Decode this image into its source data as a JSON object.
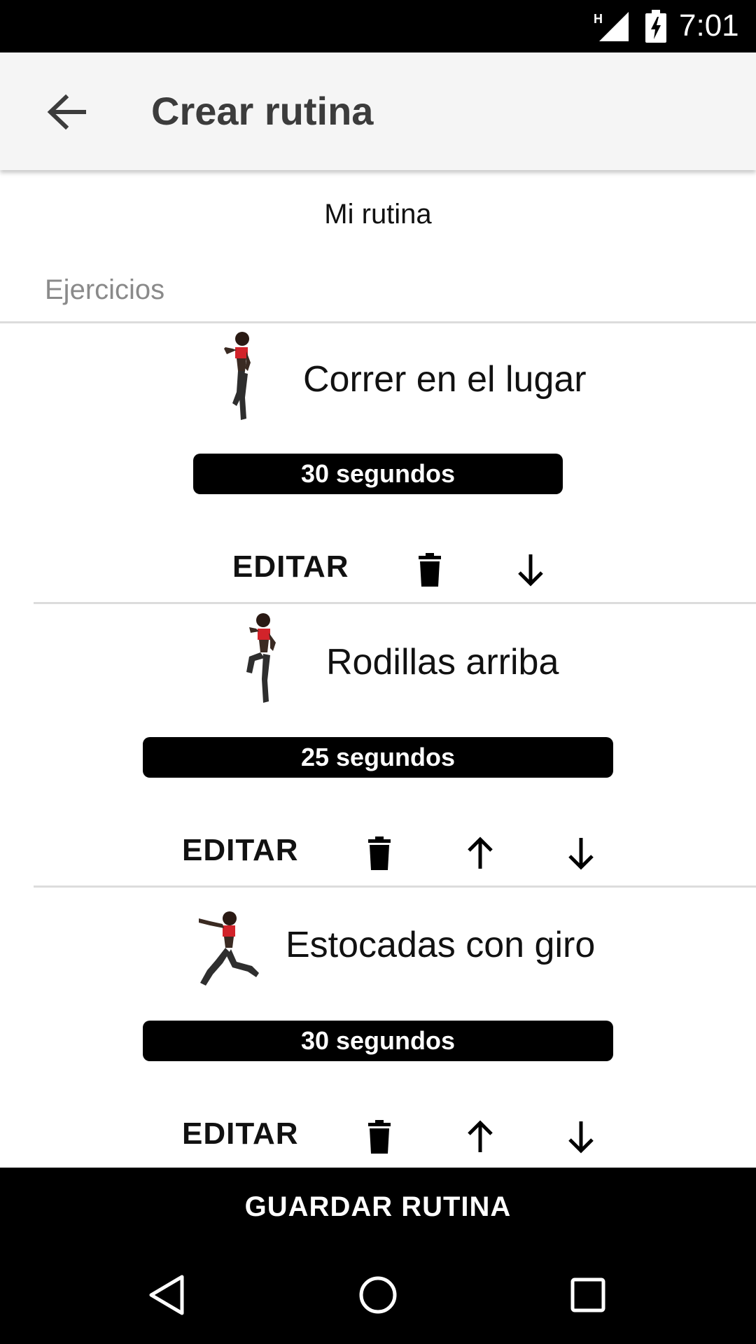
{
  "status_bar": {
    "network_label": "H",
    "time": "7:01"
  },
  "app_bar": {
    "back_icon": "arrow-left-icon",
    "title": "Crear rutina"
  },
  "routine": {
    "name": "Mi rutina",
    "section_label": "Ejercicios"
  },
  "exercises": [
    {
      "name": "Correr en el lugar",
      "duration": "30 segundos",
      "edit_label": "EDITAR",
      "actions": [
        "delete-icon",
        "arrow-down-icon"
      ]
    },
    {
      "name": "Rodillas arriba",
      "duration": "25 segundos",
      "edit_label": "EDITAR",
      "actions": [
        "delete-icon",
        "arrow-up-icon",
        "arrow-down-icon"
      ]
    },
    {
      "name": "Estocadas con giro",
      "duration": "30 segundos",
      "edit_label": "EDITAR",
      "actions": [
        "delete-icon",
        "arrow-up-icon",
        "arrow-down-icon"
      ]
    }
  ],
  "save_button": {
    "label": "GUARDAR RUTINA"
  },
  "nav_bar": {
    "icons": [
      "nav-back-icon",
      "nav-home-icon",
      "nav-recents-icon"
    ]
  },
  "colors": {
    "app_bar_bg": "#f5f5f5",
    "pill_bg": "#000000",
    "figure_accent": "#d2232a"
  }
}
